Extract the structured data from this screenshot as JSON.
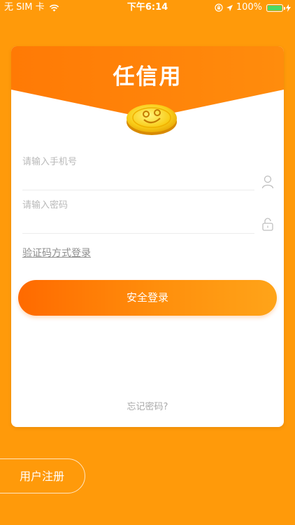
{
  "status_bar": {
    "carrier": "无 SIM 卡",
    "time": "下午6:14",
    "battery": "100%",
    "battery_level": 1.0
  },
  "header": {
    "title": "任信用"
  },
  "form": {
    "phone_placeholder": "请输入手机号",
    "password_placeholder": "请输入密码",
    "code_login_link": "验证码方式登录",
    "login_button": "安全登录",
    "forgot_password": "忘记密码?"
  },
  "footer": {
    "register_button": "用户注册"
  },
  "colors": {
    "background": "#ff9a0a",
    "accent": "#ff7800",
    "card": "#ffffff",
    "battery": "#4cd964"
  },
  "icons": {
    "user": "user-icon",
    "lock": "lock-icon",
    "coin": "coin-smiley-icon",
    "wifi": "wifi-icon",
    "location": "location-arrow-icon",
    "rotation_lock": "rotation-lock-icon",
    "charging": "charging-bolt-icon"
  }
}
